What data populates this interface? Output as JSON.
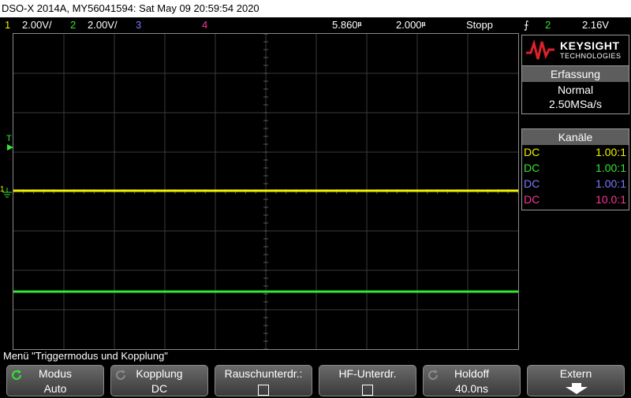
{
  "title": "DSO-X 2014A, MY56041594: Sat May 09 20:59:54 2020",
  "channels_bar": {
    "ch1_num": "1",
    "ch1_scale": "2.00V/",
    "ch2_num": "2",
    "ch2_scale": "2.00V/",
    "ch3_num": "3",
    "ch4_num": "4",
    "delay": "5.860",
    "delay_unit": "s",
    "delay_prefix": "µ",
    "timebase": "2.000",
    "timebase_unit": "s",
    "timebase_prefix": "µ",
    "run_state": "Stopp",
    "trigger_source": "2",
    "trigger_level": "2.16V"
  },
  "brand": {
    "name": "KEYSIGHT",
    "sub": "TECHNOLOGIES"
  },
  "acquisition": {
    "header": "Erfassung",
    "mode": "Normal",
    "rate": "2.50MSa/s"
  },
  "channels_panel": {
    "header": "Kanäle",
    "rows": [
      {
        "coupling": "DC",
        "probe": "1.00:1"
      },
      {
        "coupling": "DC",
        "probe": "1.00:1"
      },
      {
        "coupling": "DC",
        "probe": "1.00:1"
      },
      {
        "coupling": "DC",
        "probe": "10.0:1"
      }
    ]
  },
  "markers": {
    "trigger_level": "T",
    "ch1": "1"
  },
  "menu_label": "Menü \"Triggermodus und Kopplung\"",
  "softkeys": {
    "mode": {
      "label": "Modus",
      "value": "Auto"
    },
    "coupling": {
      "label": "Kopplung",
      "value": "DC"
    },
    "noise": {
      "label": "Rauschunterdr.:"
    },
    "hf": {
      "label": "HF-Unterdr."
    },
    "holdoff": {
      "label": "Holdoff",
      "value": "40.0ns"
    },
    "external": {
      "label": "Extern"
    }
  },
  "colors": {
    "ch1": "#f2f200",
    "ch2": "#33e633",
    "ch3": "#7a7aff",
    "ch4": "#ff3399",
    "trigger_marker": "#ff9900",
    "panel_head": "#5d5d5d"
  }
}
